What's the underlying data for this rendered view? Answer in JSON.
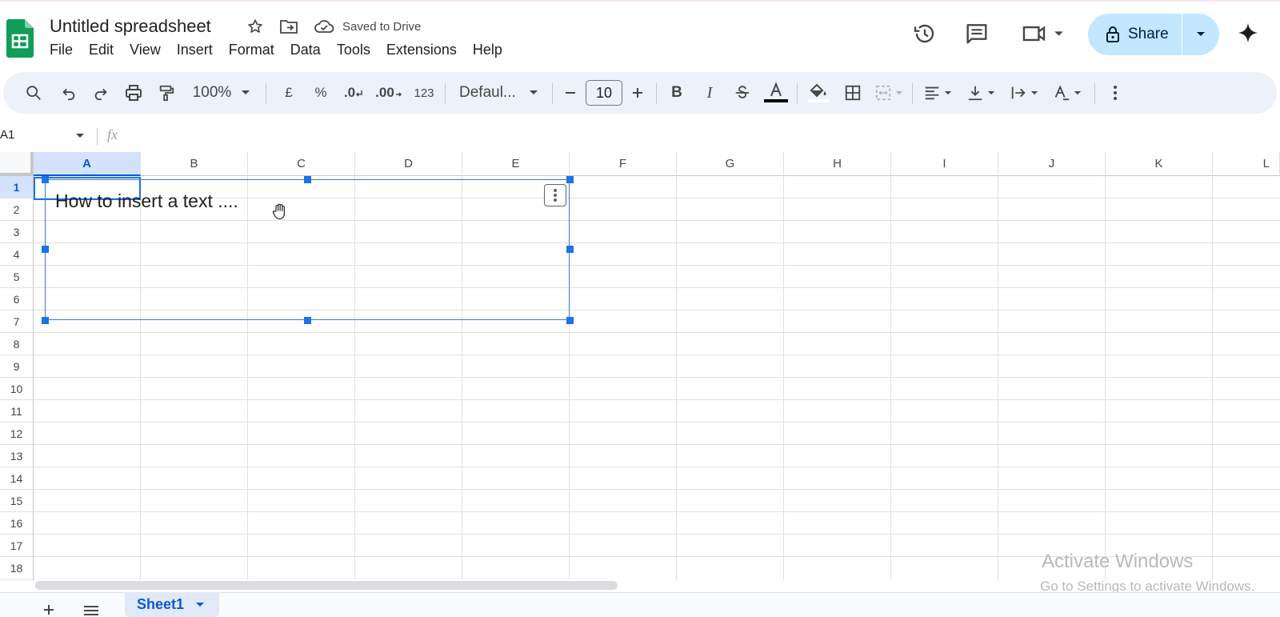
{
  "doc": {
    "title": "Untitled spreadsheet",
    "saved_status": "Saved to Drive"
  },
  "menu": [
    "File",
    "Edit",
    "View",
    "Insert",
    "Format",
    "Data",
    "Tools",
    "Extensions",
    "Help"
  ],
  "header": {
    "share_label": "Share"
  },
  "toolbar": {
    "zoom": "100%",
    "currency": "£",
    "percent": "%",
    "decrease_decimal": ".0",
    "increase_decimal": ".00",
    "number_format": "123",
    "font": "Defaul...",
    "font_size": "10",
    "bold": "B",
    "italic": "I"
  },
  "formula_bar": {
    "cell_ref": "A1",
    "fx": "fx"
  },
  "grid": {
    "columns": [
      "A",
      "B",
      "C",
      "D",
      "E",
      "F",
      "G",
      "H",
      "I",
      "J",
      "K",
      "L"
    ],
    "rows": [
      "1",
      "2",
      "3",
      "4",
      "5",
      "6",
      "7",
      "8",
      "9",
      "10",
      "11",
      "12",
      "13",
      "14",
      "15",
      "16",
      "17",
      "18"
    ],
    "selected_cell": "A1"
  },
  "drawing": {
    "text": "How to insert a text ...."
  },
  "watermark": {
    "line1": "Activate Windows",
    "line2": "Go to Settings to activate Windows."
  },
  "sheets": {
    "active": "Sheet1"
  },
  "colors": {
    "accent": "#0b57d0",
    "share_bg": "#c2e7ff",
    "toolbar_bg": "#edf2fa",
    "sheets_green": "#0f9d58"
  }
}
